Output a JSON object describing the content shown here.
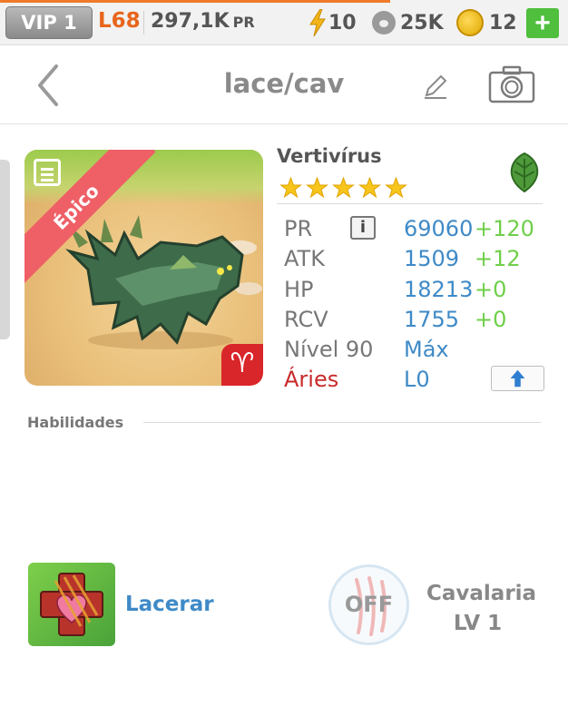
{
  "status_bar": {
    "vip": "VIP 1",
    "level": "L68",
    "power_value": "297,1K",
    "power_unit": "PR",
    "energy": "10",
    "paw": "25K",
    "coins": "12",
    "add_label": "+"
  },
  "header": {
    "title": "lace/cav",
    "icons": [
      "back-chevron-icon",
      "pencil-icon",
      "camera-icon"
    ]
  },
  "card": {
    "rarity": "Épico",
    "sign_glyph": "♈",
    "icons": [
      "memo-icon",
      "aries-icon",
      "leaf-element-icon"
    ]
  },
  "creature": {
    "name": "Vertivírus",
    "stars": 5,
    "stats": [
      {
        "label": "PR",
        "value": "69060",
        "bonus": "+120"
      },
      {
        "label": "ATK",
        "value": "1509",
        "bonus": "+12"
      },
      {
        "label": "HP",
        "value": "18213",
        "bonus": "+0"
      },
      {
        "label": "RCV",
        "value": "1755",
        "bonus": "+0"
      },
      {
        "label": "Nível 90",
        "value": "Máx",
        "bonus": ""
      },
      {
        "label": "Áries",
        "value": "L0",
        "bonus": ""
      }
    ],
    "info_label": "i"
  },
  "abilities": {
    "title": "Habilidades",
    "skill1_name": "Lacerar",
    "skill2_state": "OFF",
    "skill2_name": "Cavalaria",
    "skill2_level": "LV 1"
  },
  "colors": {
    "accent_blue": "#3f8ac7",
    "bonus_green": "#6fcf4a",
    "aries_red": "#c92a2a",
    "level_orange": "#e8651c",
    "rarity_ribbon": "#ef5f66"
  }
}
